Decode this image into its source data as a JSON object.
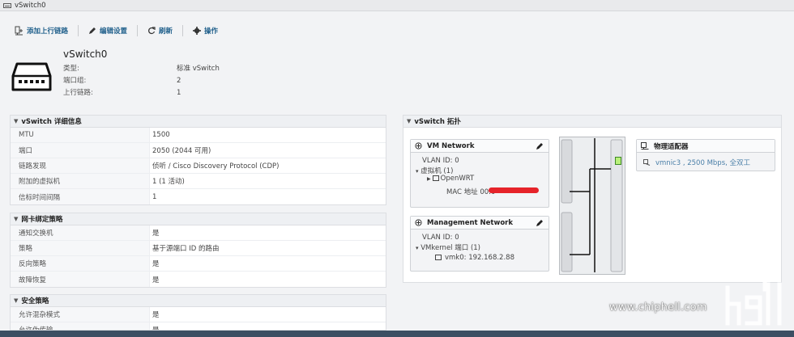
{
  "window": {
    "title": "vSwitch0"
  },
  "toolbar": {
    "add_uplink": "添加上行链路",
    "edit_settings": "编辑设置",
    "refresh": "刷新",
    "actions": "操作"
  },
  "summary": {
    "name": "vSwitch0",
    "rows": [
      {
        "label": "类型:",
        "value": "标准 vSwitch"
      },
      {
        "label": "端口组:",
        "value": "2"
      },
      {
        "label": "上行链路:",
        "value": "1"
      }
    ]
  },
  "details": {
    "title": "vSwitch 详细信息",
    "rows": [
      {
        "label": "MTU",
        "value": "1500"
      },
      {
        "label": "端口",
        "value": "2050 (2044 可用)"
      },
      {
        "label": "链路发现",
        "value": "侦听 / Cisco Discovery Protocol (CDP)"
      },
      {
        "label": "附加的虚拟机",
        "value": "1 (1 活动)"
      },
      {
        "label": "信标时间间隔",
        "value": "1"
      }
    ]
  },
  "nic_teaming": {
    "title": "网卡绑定策略",
    "rows": [
      {
        "label": "通知交换机",
        "value": "是"
      },
      {
        "label": "策略",
        "value": "基于源端口 ID 的路由"
      },
      {
        "label": "反向策略",
        "value": "是"
      },
      {
        "label": "故障恢复",
        "value": "是"
      }
    ]
  },
  "security": {
    "title": "安全策略",
    "rows": [
      {
        "label": "允许混杂模式",
        "value": "是"
      },
      {
        "label": "允许伪传输",
        "value": "是"
      }
    ]
  },
  "topology": {
    "title": "vSwitch 拓扑",
    "vm_network": {
      "name": "VM Network",
      "vlan": "VLAN ID: 0",
      "vms": "虚拟机 (1)",
      "vm_name": "OpenWRT",
      "mac": "MAC 地址 00:0"
    },
    "mgmt_network": {
      "name": "Management Network",
      "vlan": "VLAN ID: 0",
      "vmkernel": "VMkernel 端口 (1)",
      "vmk": "vmk0: 192.168.2.88"
    },
    "physical": {
      "title": "物理适配器",
      "nic": "vmnic3 , 2500 Mbps, 全双工"
    }
  },
  "watermark": {
    "site": "www.chiphell.com"
  },
  "colors": {
    "accent": "#1f5f8b",
    "link": "#4a7fa8",
    "connector": "#b9f07a"
  }
}
